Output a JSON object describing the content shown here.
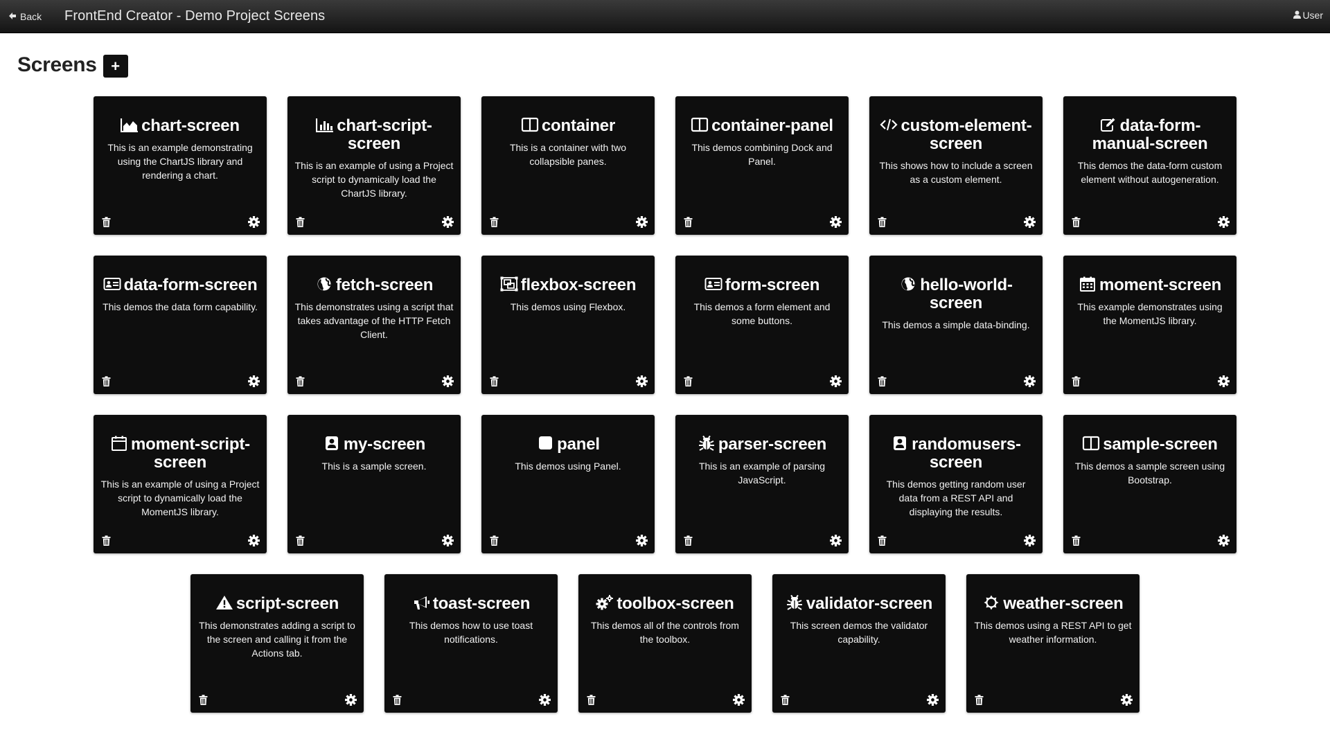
{
  "header": {
    "back_label": "Back",
    "title": "FrontEnd Creator - Demo Project Screens",
    "user_label": "User"
  },
  "page": {
    "title": "Screens",
    "add_label": "+"
  },
  "screens": [
    {
      "name": "chart-screen",
      "icon": "area-chart-icon",
      "description": "This is an example demonstrating using the ChartJS library and rendering a chart."
    },
    {
      "name": "chart-script-screen",
      "icon": "bar-chart-icon",
      "description": "This is an example of using a Project script to dynamically load the ChartJS library."
    },
    {
      "name": "container",
      "icon": "columns-icon",
      "description": "This is a container with two collapsible panes."
    },
    {
      "name": "container-panel",
      "icon": "columns-icon",
      "description": "This demos combining Dock and Panel."
    },
    {
      "name": "custom-element-screen",
      "icon": "code-icon",
      "description": "This shows how to include a screen as a custom element."
    },
    {
      "name": "data-form-manual-screen",
      "icon": "edit-icon",
      "description": "This demos the data-form custom element without autogeneration."
    },
    {
      "name": "data-form-screen",
      "icon": "id-card-icon",
      "description": "This demos the data form capability."
    },
    {
      "name": "fetch-screen",
      "icon": "globe-icon",
      "description": "This demonstrates using a script that takes advantage of the HTTP Fetch Client."
    },
    {
      "name": "flexbox-screen",
      "icon": "object-group-icon",
      "description": "This demos using Flexbox."
    },
    {
      "name": "form-screen",
      "icon": "id-card-icon",
      "description": "This demos a form element and some buttons."
    },
    {
      "name": "hello-world-screen",
      "icon": "globe-icon",
      "description": "This demos a simple data-binding."
    },
    {
      "name": "moment-screen",
      "icon": "calendar-icon",
      "description": "This example demonstrates using the MomentJS library."
    },
    {
      "name": "moment-script-screen",
      "icon": "calendar-outline-icon",
      "description": "This is an example of using a Project script to dynamically load the MomentJS library."
    },
    {
      "name": "my-screen",
      "icon": "user-square-icon",
      "description": "This is a sample screen."
    },
    {
      "name": "panel",
      "icon": "square-icon",
      "description": "This demos using Panel."
    },
    {
      "name": "parser-screen",
      "icon": "bug-icon",
      "description": "This is an example of parsing JavaScript."
    },
    {
      "name": "randomusers-screen",
      "icon": "user-square-icon",
      "description": "This demos getting random user data from a REST API and displaying the results."
    },
    {
      "name": "sample-screen",
      "icon": "columns-icon",
      "description": "This demos a sample screen using Bootstrap."
    },
    {
      "name": "script-screen",
      "icon": "warning-icon",
      "description": "This demonstrates adding a script to the screen and calling it from the Actions tab."
    },
    {
      "name": "toast-screen",
      "icon": "bullhorn-icon",
      "description": "This demos how to use toast notifications."
    },
    {
      "name": "toolbox-screen",
      "icon": "cogs-icon",
      "description": "This demos all of the controls from the toolbox."
    },
    {
      "name": "validator-screen",
      "icon": "bug-icon",
      "description": "This screen demos the validator capability."
    },
    {
      "name": "weather-screen",
      "icon": "sun-icon",
      "description": "This demos using a REST API to get weather information."
    }
  ],
  "card_actions": {
    "delete_icon": "trash-icon",
    "settings_icon": "gear-icon"
  }
}
